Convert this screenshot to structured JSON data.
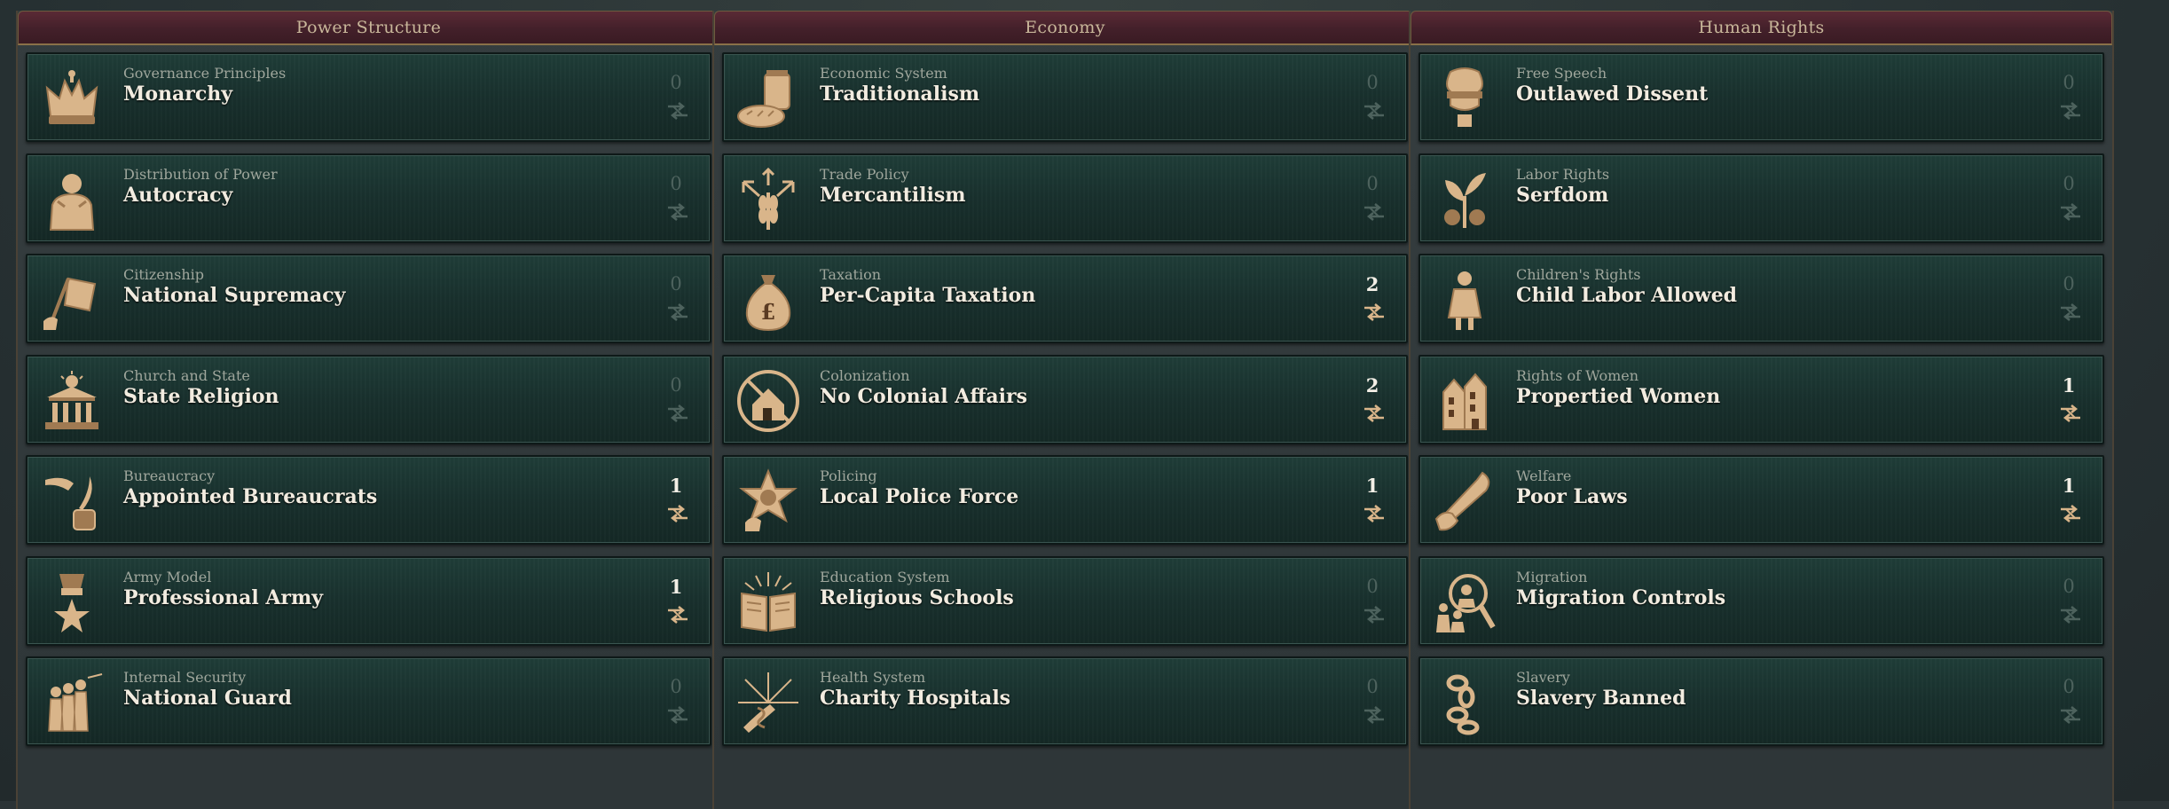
{
  "colors": {
    "header_bg": "#4a2430",
    "header_text": "#c9b79a",
    "card_bg": "#1a3330",
    "active_count": "#f3efe6",
    "inactive_count": "#4d625d",
    "icon_gold": "#d9b58a"
  },
  "columns": [
    {
      "title": "Power Structure",
      "laws": [
        {
          "category": "Governance Principles",
          "name": "Monarchy",
          "count": "0",
          "active": false,
          "icon": "crown-icon"
        },
        {
          "category": "Distribution of Power",
          "name": "Autocracy",
          "count": "0",
          "active": false,
          "icon": "autocrat-bust-icon"
        },
        {
          "category": "Citizenship",
          "name": "National Supremacy",
          "count": "0",
          "active": false,
          "icon": "raised-flag-icon"
        },
        {
          "category": "Church and State",
          "name": "State Religion",
          "count": "0",
          "active": false,
          "icon": "temple-icon"
        },
        {
          "category": "Bureaucracy",
          "name": "Appointed Bureaucrats",
          "count": "1",
          "active": true,
          "icon": "quill-inkwell-icon"
        },
        {
          "category": "Army Model",
          "name": "Professional Army",
          "count": "1",
          "active": true,
          "icon": "star-medal-icon"
        },
        {
          "category": "Internal Security",
          "name": "National Guard",
          "count": "0",
          "active": false,
          "icon": "soldiers-icon"
        }
      ]
    },
    {
      "title": "Economy",
      "laws": [
        {
          "category": "Economic System",
          "name": "Traditionalism",
          "count": "0",
          "active": false,
          "icon": "bread-jar-icon"
        },
        {
          "category": "Trade Policy",
          "name": "Mercantilism",
          "count": "0",
          "active": false,
          "icon": "wheat-arrows-icon"
        },
        {
          "category": "Taxation",
          "name": "Per-Capita Taxation",
          "count": "2",
          "active": true,
          "icon": "money-bag-icon"
        },
        {
          "category": "Colonization",
          "name": "No Colonial Affairs",
          "count": "2",
          "active": true,
          "icon": "no-house-icon"
        },
        {
          "category": "Policing",
          "name": "Local Police Force",
          "count": "1",
          "active": true,
          "icon": "sheriff-badge-icon"
        },
        {
          "category": "Education System",
          "name": "Religious Schools",
          "count": "0",
          "active": false,
          "icon": "open-book-icon"
        },
        {
          "category": "Health System",
          "name": "Charity Hospitals",
          "count": "0",
          "active": false,
          "icon": "caduceus-burst-icon"
        }
      ]
    },
    {
      "title": "Human Rights",
      "laws": [
        {
          "category": "Free Speech",
          "name": "Outlawed Dissent",
          "count": "0",
          "active": false,
          "icon": "gagged-head-icon"
        },
        {
          "category": "Labor Rights",
          "name": "Serfdom",
          "count": "0",
          "active": false,
          "icon": "plant-sprout-icon"
        },
        {
          "category": "Children's Rights",
          "name": "Child Labor Allowed",
          "count": "0",
          "active": false,
          "icon": "child-figure-icon"
        },
        {
          "category": "Rights of Women",
          "name": "Propertied Women",
          "count": "1",
          "active": true,
          "icon": "townhouse-icon"
        },
        {
          "category": "Welfare",
          "name": "Poor Laws",
          "count": "1",
          "active": true,
          "icon": "helping-hand-icon"
        },
        {
          "category": "Migration",
          "name": "Migration Controls",
          "count": "0",
          "active": false,
          "icon": "magnifier-crowd-icon"
        },
        {
          "category": "Slavery",
          "name": "Slavery Banned",
          "count": "0",
          "active": false,
          "icon": "broken-chain-icon"
        }
      ]
    }
  ]
}
